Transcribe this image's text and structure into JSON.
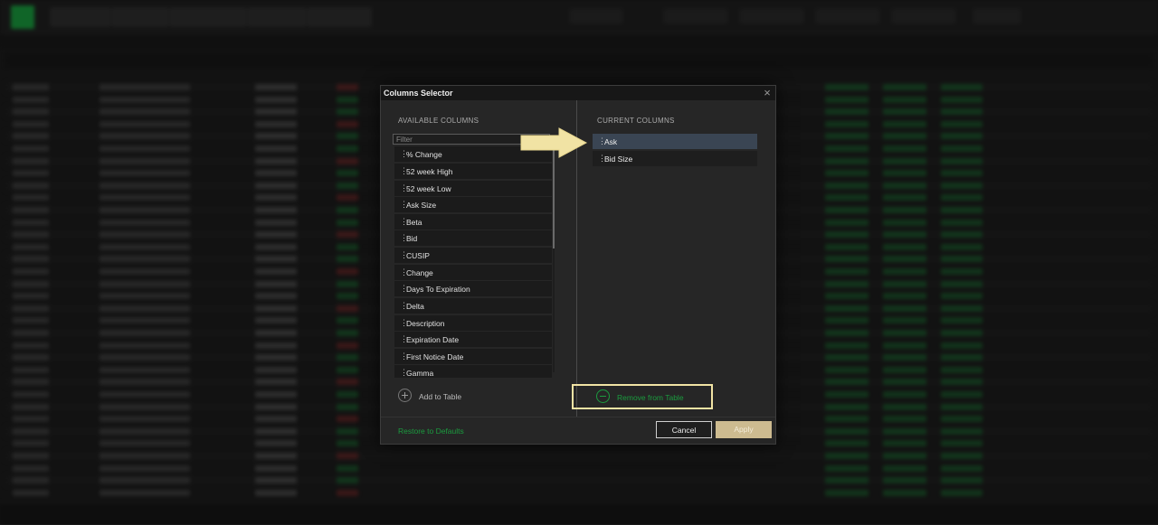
{
  "dialog": {
    "title": "Columns Selector",
    "available_header": "AVAILABLE COLUMNS",
    "current_header": "CURRENT COLUMNS",
    "filter_placeholder": "Filter",
    "available": [
      "% Change",
      "52 week High",
      "52 week Low",
      "Ask Size",
      "Beta",
      "Bid",
      "CUSIP",
      "Change",
      "Days To Expiration",
      "Delta",
      "Description",
      "Expiration Date",
      "First Notice Date",
      "Gamma"
    ],
    "current": [
      "Ask",
      "Bid Size"
    ],
    "selected_current": "Ask",
    "add_label": "Add to Table",
    "remove_label": "Remove from Table",
    "restore_label": "Restore to Defaults",
    "cancel_label": "Cancel",
    "apply_label": "Apply"
  },
  "colors": {
    "accent_green": "#1b9c3f",
    "highlight_yellow": "#f1e3a4",
    "selected_row": "#3a4553",
    "apply_button": "#cdbb90"
  },
  "icons": {
    "close": "close-icon",
    "add": "plus-circle-icon",
    "remove": "minus-circle-icon",
    "grip": "drag-grip-icon",
    "arrow": "arrow-right-icon"
  }
}
